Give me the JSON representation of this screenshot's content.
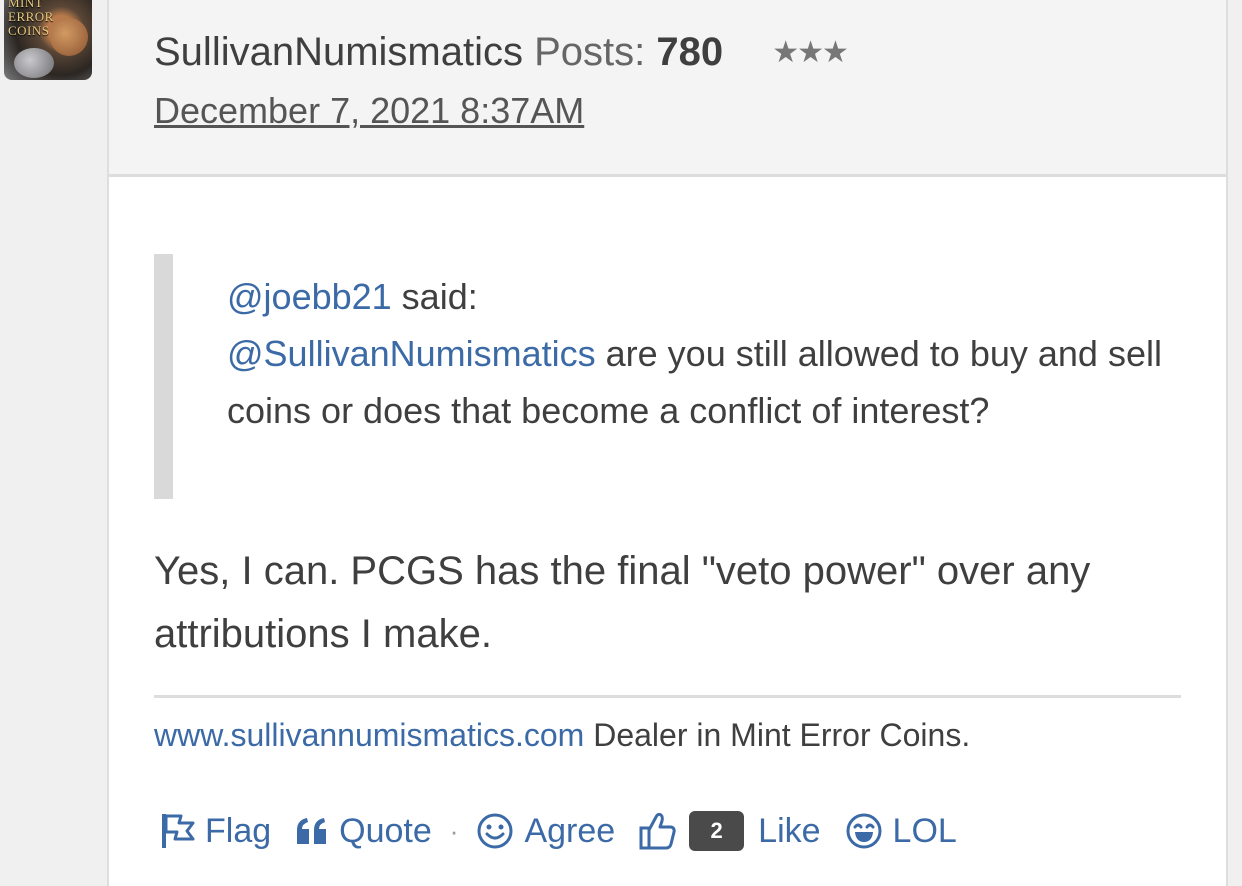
{
  "author": {
    "avatar_text": "MINT ERROR COINS",
    "name": "SullivanNumismatics",
    "posts_label": "Posts:",
    "posts_count": "780",
    "rank_stars": "★★★",
    "date": "December 7, 2021 8:37AM"
  },
  "quote": {
    "author_mention": "@joebb21",
    "said_text": " said:",
    "mention": "@SullivanNumismatics",
    "body": " are you still allowed to buy and sell coins or does that become a conflict of interest?"
  },
  "message": {
    "text": "Yes, I can. PCGS has the final \"veto power\" over any attributions I make."
  },
  "signature": {
    "link": "www.sullivannumismatics.com",
    "text": " Dealer in Mint Error Coins."
  },
  "reactions": {
    "flag": "Flag",
    "quote": "Quote",
    "separator": "·",
    "agree": "Agree",
    "like_count": "2",
    "like": "Like",
    "lol": "LOL"
  },
  "colors": {
    "link": "#3b6aa6",
    "text": "#3f3f3f",
    "header_bg": "#f4f4f4",
    "badge_bg": "#4a4a4a"
  },
  "icons": [
    "flag-icon",
    "quote-icon",
    "agree-smile-icon",
    "like-thumbs-up-icon",
    "lol-laugh-icon"
  ]
}
